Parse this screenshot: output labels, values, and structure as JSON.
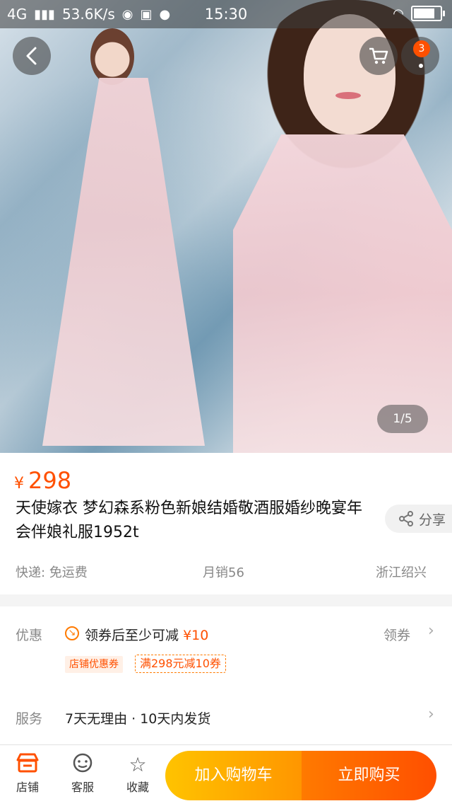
{
  "status_bar": {
    "network": "4G",
    "speed": "53.6K/s",
    "time": "15:30"
  },
  "gallery": {
    "page_indicator": "1/5",
    "cart_badge": "3"
  },
  "product": {
    "currency": "¥",
    "price": "298",
    "title": "天使嫁衣 梦幻森系粉色新娘结婚敬酒服婚纱晚宴年会伴娘礼服1952t",
    "share_label": "分享",
    "shipping": "快递: 免运费",
    "monthly_sales": "月销56",
    "location": "浙江绍兴"
  },
  "promotion": {
    "label": "优惠",
    "coupon_text": "领券后至少可减",
    "coupon_amount": "¥10",
    "get_coupon": "领券",
    "tag_store": "店铺优惠券",
    "tag_deal": "满298元减10券"
  },
  "service": {
    "label": "服务",
    "text": "7天无理由 · 10天内发货"
  },
  "bottom_bar": {
    "store": "店铺",
    "support": "客服",
    "favorite": "收藏",
    "add_to_cart": "加入购物车",
    "buy_now": "立即购买"
  },
  "colors": {
    "accent": "#ff5000",
    "cart_button": "#ff9600",
    "buy_button": "#ff4f00"
  },
  "battery_level": 0.9
}
